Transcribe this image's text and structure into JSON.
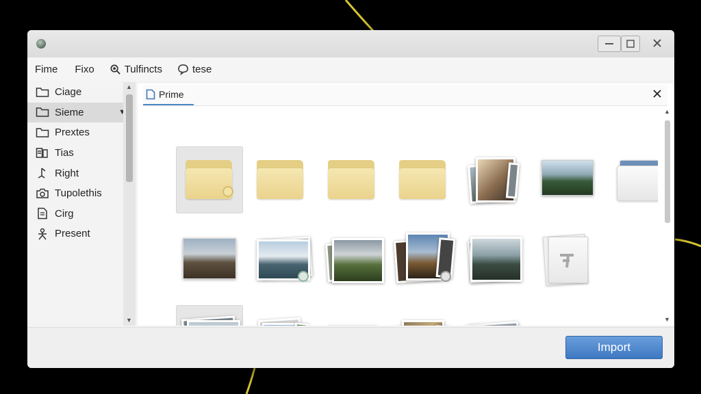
{
  "menu": {
    "items": [
      {
        "label": "Fime"
      },
      {
        "label": "Fixo"
      },
      {
        "label": "Tulfincts",
        "icon": "search-icon"
      },
      {
        "label": "tese",
        "icon": "chat-icon"
      }
    ]
  },
  "sidebar": {
    "items": [
      {
        "label": "Ciage",
        "icon": "folder-icon"
      },
      {
        "label": "Sieme",
        "icon": "folder-icon",
        "selected": true,
        "arrow": "chevron-down-icon"
      },
      {
        "label": "Prextes",
        "icon": "folder-icon"
      },
      {
        "label": "Tias",
        "icon": "image-stack-icon",
        "arrow": "chevron-right-icon"
      },
      {
        "label": "Right",
        "icon": "music-note-icon"
      },
      {
        "label": "Tupolethis",
        "icon": "camera-icon"
      },
      {
        "label": "Cirg",
        "icon": "document-icon"
      },
      {
        "label": "Present",
        "icon": "person-icon"
      }
    ]
  },
  "tab": {
    "label": "Prime",
    "icon": "document-icon"
  },
  "footer": {
    "import_label": "Import"
  },
  "colors": {
    "accent": "#3e78c2",
    "folder": "#ead38c",
    "selection": "#dadada"
  }
}
